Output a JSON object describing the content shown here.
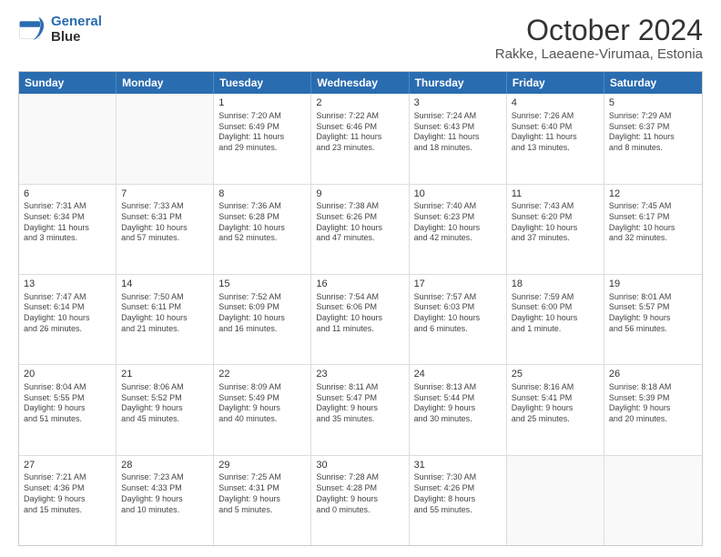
{
  "logo": {
    "line1": "General",
    "line2": "Blue"
  },
  "title": "October 2024",
  "subtitle": "Rakke, Laeaene-Virumaa, Estonia",
  "days": [
    "Sunday",
    "Monday",
    "Tuesday",
    "Wednesday",
    "Thursday",
    "Friday",
    "Saturday"
  ],
  "weeks": [
    [
      {
        "day": "",
        "text": ""
      },
      {
        "day": "",
        "text": ""
      },
      {
        "day": "1",
        "text": "Sunrise: 7:20 AM\nSunset: 6:49 PM\nDaylight: 11 hours\nand 29 minutes."
      },
      {
        "day": "2",
        "text": "Sunrise: 7:22 AM\nSunset: 6:46 PM\nDaylight: 11 hours\nand 23 minutes."
      },
      {
        "day": "3",
        "text": "Sunrise: 7:24 AM\nSunset: 6:43 PM\nDaylight: 11 hours\nand 18 minutes."
      },
      {
        "day": "4",
        "text": "Sunrise: 7:26 AM\nSunset: 6:40 PM\nDaylight: 11 hours\nand 13 minutes."
      },
      {
        "day": "5",
        "text": "Sunrise: 7:29 AM\nSunset: 6:37 PM\nDaylight: 11 hours\nand 8 minutes."
      }
    ],
    [
      {
        "day": "6",
        "text": "Sunrise: 7:31 AM\nSunset: 6:34 PM\nDaylight: 11 hours\nand 3 minutes."
      },
      {
        "day": "7",
        "text": "Sunrise: 7:33 AM\nSunset: 6:31 PM\nDaylight: 10 hours\nand 57 minutes."
      },
      {
        "day": "8",
        "text": "Sunrise: 7:36 AM\nSunset: 6:28 PM\nDaylight: 10 hours\nand 52 minutes."
      },
      {
        "day": "9",
        "text": "Sunrise: 7:38 AM\nSunset: 6:26 PM\nDaylight: 10 hours\nand 47 minutes."
      },
      {
        "day": "10",
        "text": "Sunrise: 7:40 AM\nSunset: 6:23 PM\nDaylight: 10 hours\nand 42 minutes."
      },
      {
        "day": "11",
        "text": "Sunrise: 7:43 AM\nSunset: 6:20 PM\nDaylight: 10 hours\nand 37 minutes."
      },
      {
        "day": "12",
        "text": "Sunrise: 7:45 AM\nSunset: 6:17 PM\nDaylight: 10 hours\nand 32 minutes."
      }
    ],
    [
      {
        "day": "13",
        "text": "Sunrise: 7:47 AM\nSunset: 6:14 PM\nDaylight: 10 hours\nand 26 minutes."
      },
      {
        "day": "14",
        "text": "Sunrise: 7:50 AM\nSunset: 6:11 PM\nDaylight: 10 hours\nand 21 minutes."
      },
      {
        "day": "15",
        "text": "Sunrise: 7:52 AM\nSunset: 6:09 PM\nDaylight: 10 hours\nand 16 minutes."
      },
      {
        "day": "16",
        "text": "Sunrise: 7:54 AM\nSunset: 6:06 PM\nDaylight: 10 hours\nand 11 minutes."
      },
      {
        "day": "17",
        "text": "Sunrise: 7:57 AM\nSunset: 6:03 PM\nDaylight: 10 hours\nand 6 minutes."
      },
      {
        "day": "18",
        "text": "Sunrise: 7:59 AM\nSunset: 6:00 PM\nDaylight: 10 hours\nand 1 minute."
      },
      {
        "day": "19",
        "text": "Sunrise: 8:01 AM\nSunset: 5:57 PM\nDaylight: 9 hours\nand 56 minutes."
      }
    ],
    [
      {
        "day": "20",
        "text": "Sunrise: 8:04 AM\nSunset: 5:55 PM\nDaylight: 9 hours\nand 51 minutes."
      },
      {
        "day": "21",
        "text": "Sunrise: 8:06 AM\nSunset: 5:52 PM\nDaylight: 9 hours\nand 45 minutes."
      },
      {
        "day": "22",
        "text": "Sunrise: 8:09 AM\nSunset: 5:49 PM\nDaylight: 9 hours\nand 40 minutes."
      },
      {
        "day": "23",
        "text": "Sunrise: 8:11 AM\nSunset: 5:47 PM\nDaylight: 9 hours\nand 35 minutes."
      },
      {
        "day": "24",
        "text": "Sunrise: 8:13 AM\nSunset: 5:44 PM\nDaylight: 9 hours\nand 30 minutes."
      },
      {
        "day": "25",
        "text": "Sunrise: 8:16 AM\nSunset: 5:41 PM\nDaylight: 9 hours\nand 25 minutes."
      },
      {
        "day": "26",
        "text": "Sunrise: 8:18 AM\nSunset: 5:39 PM\nDaylight: 9 hours\nand 20 minutes."
      }
    ],
    [
      {
        "day": "27",
        "text": "Sunrise: 7:21 AM\nSunset: 4:36 PM\nDaylight: 9 hours\nand 15 minutes."
      },
      {
        "day": "28",
        "text": "Sunrise: 7:23 AM\nSunset: 4:33 PM\nDaylight: 9 hours\nand 10 minutes."
      },
      {
        "day": "29",
        "text": "Sunrise: 7:25 AM\nSunset: 4:31 PM\nDaylight: 9 hours\nand 5 minutes."
      },
      {
        "day": "30",
        "text": "Sunrise: 7:28 AM\nSunset: 4:28 PM\nDaylight: 9 hours\nand 0 minutes."
      },
      {
        "day": "31",
        "text": "Sunrise: 7:30 AM\nSunset: 4:26 PM\nDaylight: 8 hours\nand 55 minutes."
      },
      {
        "day": "",
        "text": ""
      },
      {
        "day": "",
        "text": ""
      }
    ]
  ]
}
